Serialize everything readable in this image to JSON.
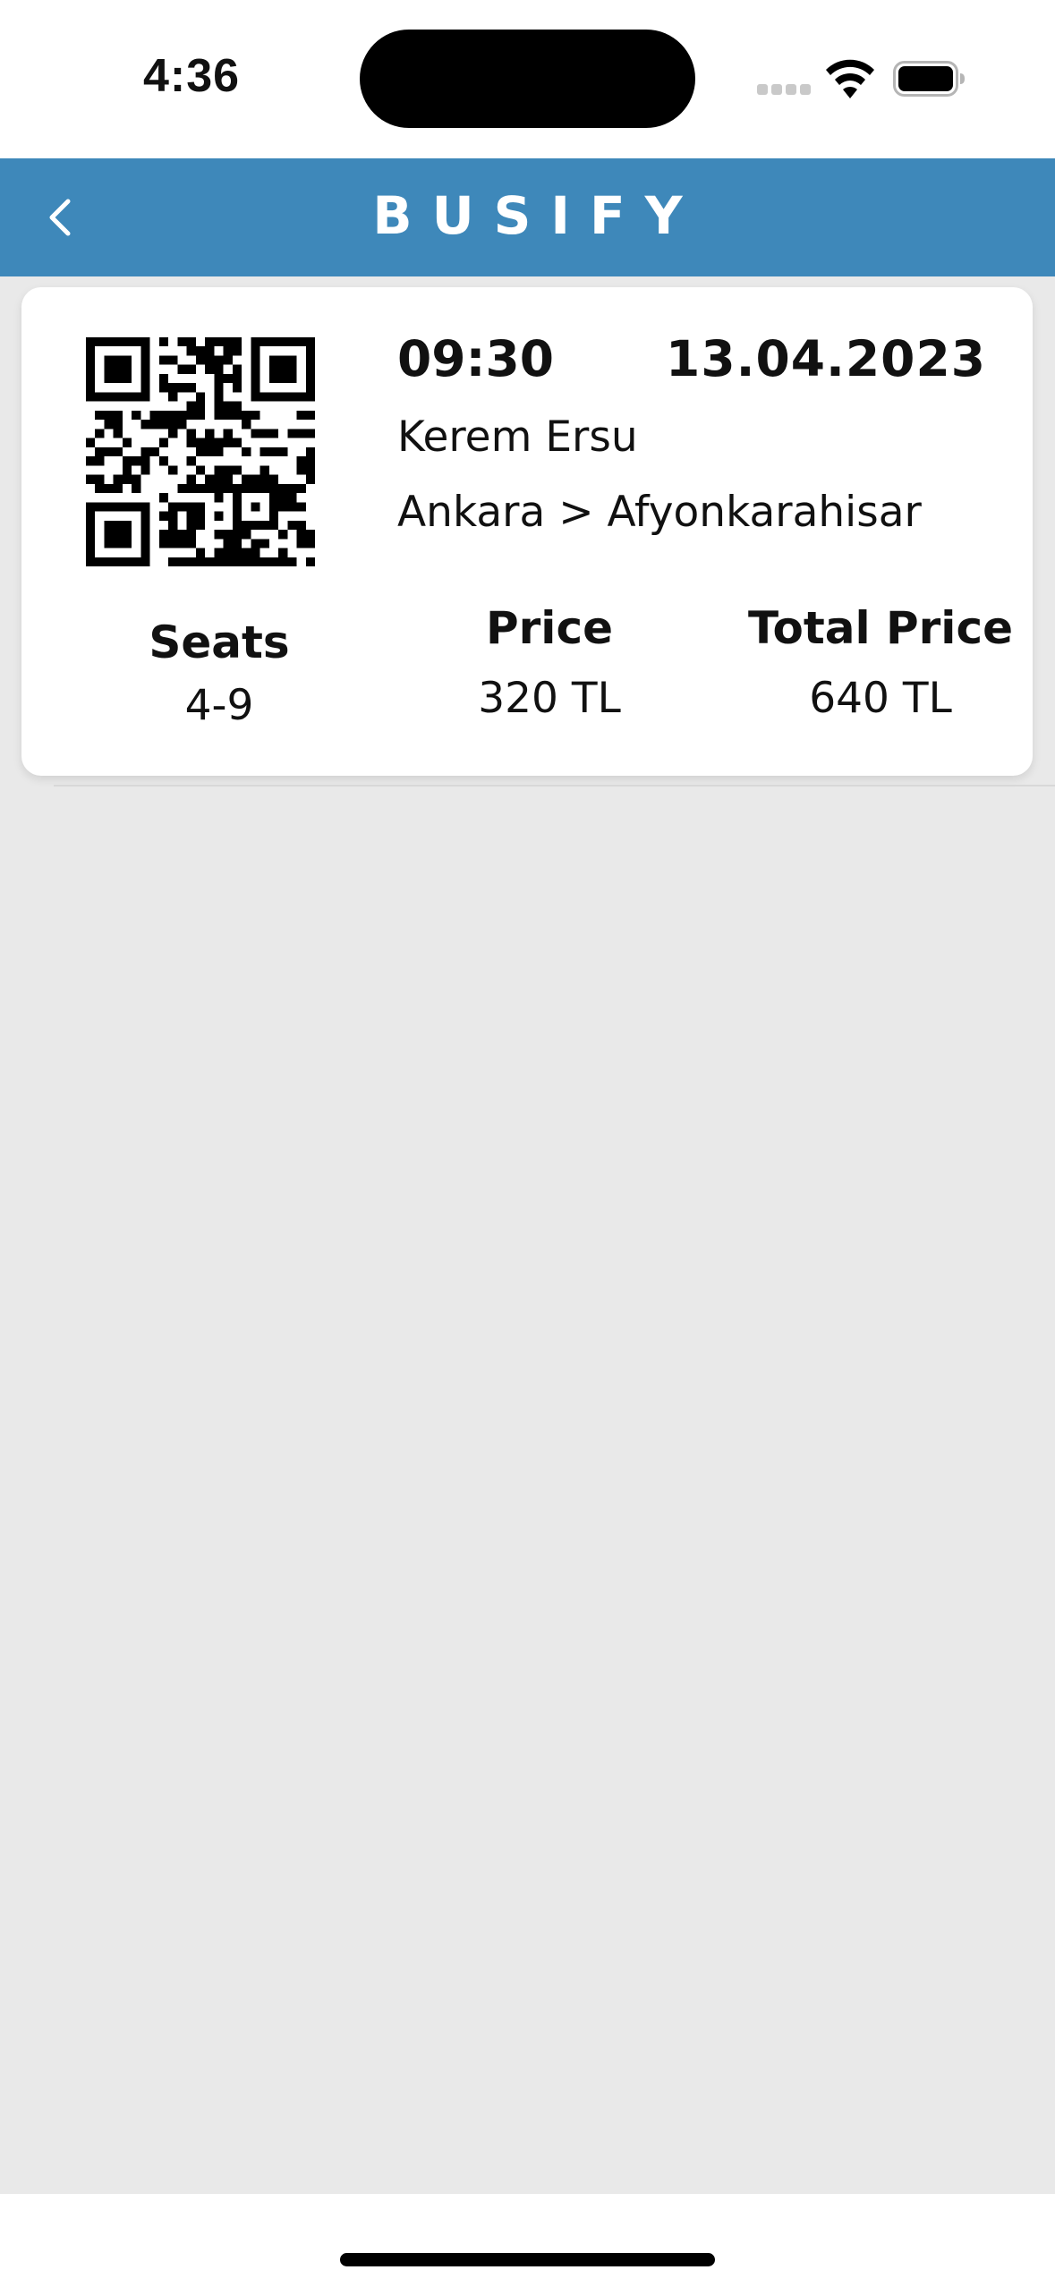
{
  "status_bar": {
    "time": "4:36",
    "signal_icon": "signal-icon",
    "wifi_icon": "wifi-icon",
    "battery_icon": "battery-icon"
  },
  "header": {
    "title": "BUSIFY",
    "back_icon": "chevron-left-icon",
    "color": "#3e88ba"
  },
  "ticket": {
    "time": "09:30",
    "date": "13.04.2023",
    "passenger": "Kerem Ersu",
    "route": "Ankara > Afyonkarahisar",
    "seats_label": "Seats",
    "seats_value": "4-9",
    "price_label": "Price",
    "price_value": "320 TL",
    "total_label": "Total Price",
    "total_value": "640 TL",
    "qr_icon": "qr-code-icon"
  }
}
